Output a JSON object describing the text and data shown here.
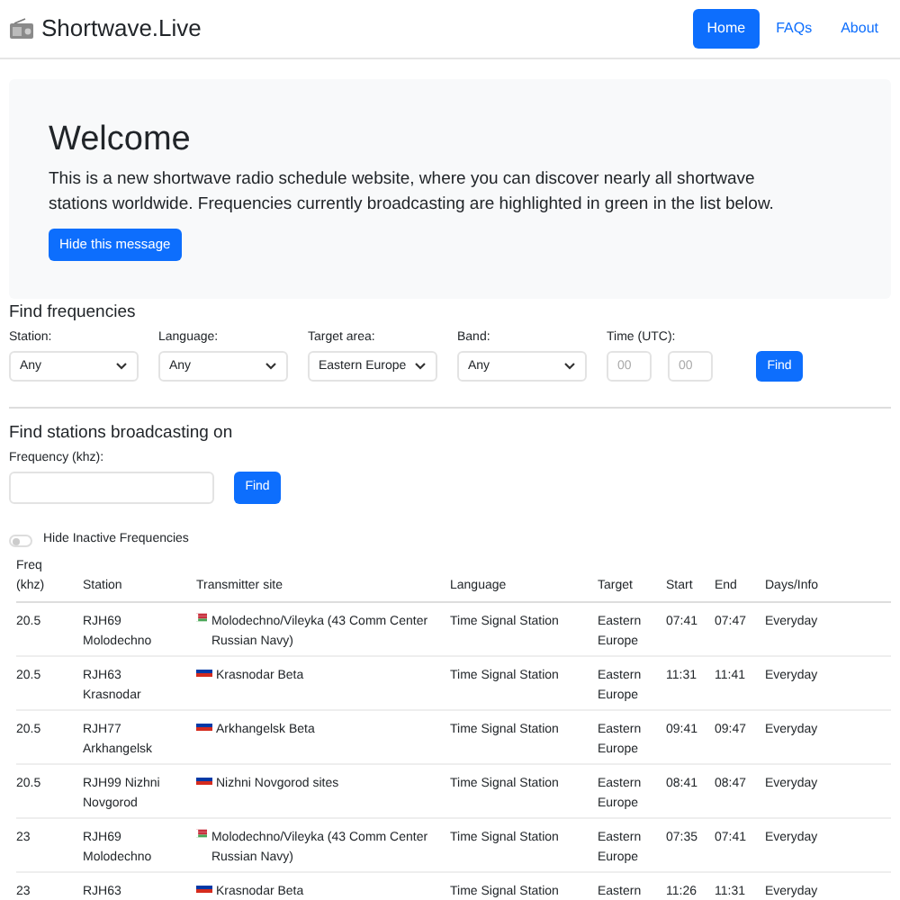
{
  "brand": {
    "title": "Shortwave.Live"
  },
  "nav": [
    {
      "label": "Home",
      "selected": true
    },
    {
      "label": "FAQs",
      "selected": false
    },
    {
      "label": "About",
      "selected": false
    }
  ],
  "welcome": {
    "title": "Welcome",
    "text": "This is a new shortwave radio schedule website, where you can discover nearly all shortwave stations worldwide. Frequencies currently broadcasting are highlighted in green in the list below.",
    "button": "Hide this message"
  },
  "find_frequencies": {
    "title": "Find frequencies",
    "filters": [
      {
        "label": "Station:",
        "value": "Any"
      },
      {
        "label": "Language:",
        "value": "Any"
      },
      {
        "label": "Target area:",
        "value": "Eastern Europe"
      },
      {
        "label": "Band:",
        "value": "Any"
      }
    ],
    "time": {
      "label": "Time (UTC):",
      "hour_placeholder": "00",
      "minute_placeholder": "00"
    },
    "button": "Find"
  },
  "find_stations": {
    "title": "Find stations broadcasting on",
    "label": "Frequency (khz):",
    "button": "Find"
  },
  "hide_inactive": {
    "label": "Hide Inactive Frequencies",
    "on": false
  },
  "table": {
    "columns": [
      "Freq (khz)",
      "Station",
      "Transmitter site",
      "Language",
      "Target",
      "Start",
      "End",
      "Days/Info"
    ],
    "rows": [
      {
        "freq": "20.5",
        "station": "RJH69 Molodechno",
        "kind": "belarus",
        "site": "Molodechno/Vileyka (43 Comm Center Russian Navy)",
        "language": "Time Signal Station",
        "target": "Eastern Europe",
        "start": "07:41",
        "end": "07:47",
        "days": "Everyday"
      },
      {
        "freq": "20.5",
        "station": "RJH63 Krasnodar",
        "kind": "russia",
        "site": "Krasnodar Beta",
        "language": "Time Signal Station",
        "target": "Eastern Europe",
        "start": "11:31",
        "end": "11:41",
        "days": "Everyday"
      },
      {
        "freq": "20.5",
        "station": "RJH77 Arkhangelsk",
        "kind": "russia",
        "site": "Arkhangelsk Beta",
        "language": "Time Signal Station",
        "target": "Eastern Europe",
        "start": "09:41",
        "end": "09:47",
        "days": "Everyday"
      },
      {
        "freq": "20.5",
        "station": "RJH99 Nizhni Novgorod",
        "kind": "russia",
        "site": "Nizhni Novgorod sites",
        "language": "Time Signal Station",
        "target": "Eastern Europe",
        "start": "08:41",
        "end": "08:47",
        "days": "Everyday"
      },
      {
        "freq": "23",
        "station": "RJH69 Molodechno",
        "kind": "belarus",
        "site": "Molodechno/Vileyka (43 Comm Center Russian Navy)",
        "language": "Time Signal Station",
        "target": "Eastern Europe",
        "start": "07:35",
        "end": "07:41",
        "days": "Everyday"
      },
      {
        "freq": "23",
        "station": "RJH63",
        "kind": "russia",
        "site": "Krasnodar Beta",
        "language": "Time Signal Station",
        "target": "Eastern",
        "start": "11:26",
        "end": "11:31",
        "days": "Everyday"
      }
    ]
  }
}
